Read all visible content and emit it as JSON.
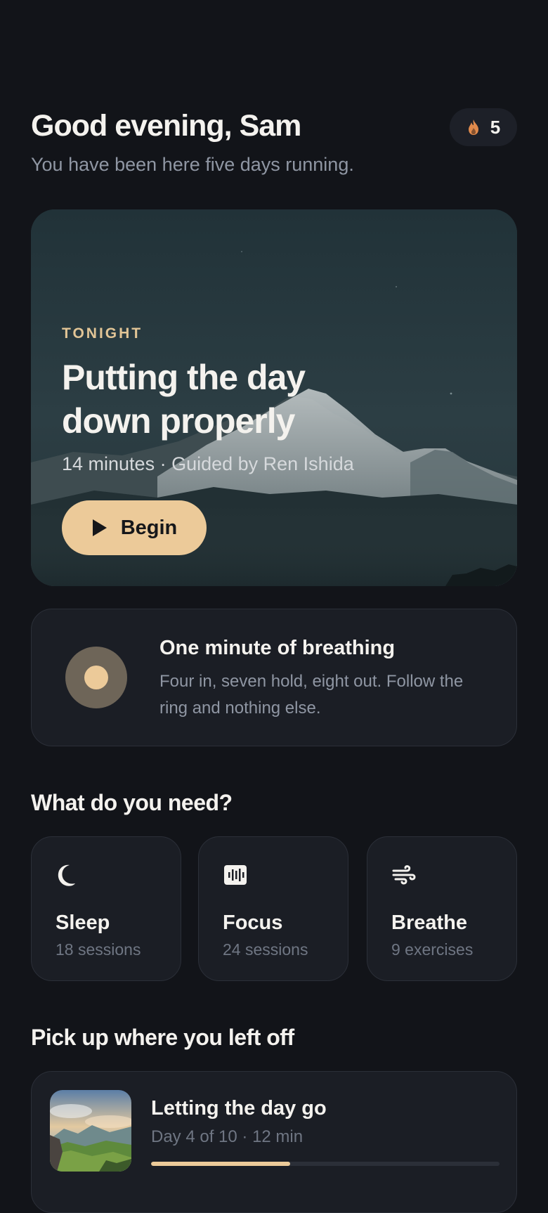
{
  "header": {
    "greeting": "Good evening, Sam",
    "subtitle": "You have been here five days running.",
    "streak": {
      "icon": "flame-icon",
      "count": "5",
      "icon_color": "#e08a4c"
    }
  },
  "hero": {
    "eyebrow": "TONIGHT",
    "title": "Putting the day down properly",
    "meta": "14 minutes · Guided by Ren Ishida",
    "button": {
      "icon": "play-icon",
      "label": "Begin"
    }
  },
  "breathing_card": {
    "icon": "breathing-ring-icon",
    "title": "One minute of breathing",
    "description": "Four in, seven hold, eight out. Follow the ring and nothing else."
  },
  "needs": {
    "title": "What do you need?",
    "tiles": [
      {
        "icon": "moon-icon",
        "label": "Sleep",
        "count": "18 sessions"
      },
      {
        "icon": "soundwave-icon",
        "label": "Focus",
        "count": "24 sessions"
      },
      {
        "icon": "wind-icon",
        "label": "Breathe",
        "count": "9 exercises"
      }
    ]
  },
  "resume": {
    "title": "Pick up where you left off",
    "item": {
      "thumbnail": "mountain-landscape-thumbnail",
      "title": "Letting the day go",
      "meta": "Day 4 of 10 · 12 min",
      "progress": 0.4
    }
  },
  "colors": {
    "background": "#121419",
    "card": "#1b1e25",
    "accent": "#ecca99",
    "muted_text": "#8f96a3"
  }
}
